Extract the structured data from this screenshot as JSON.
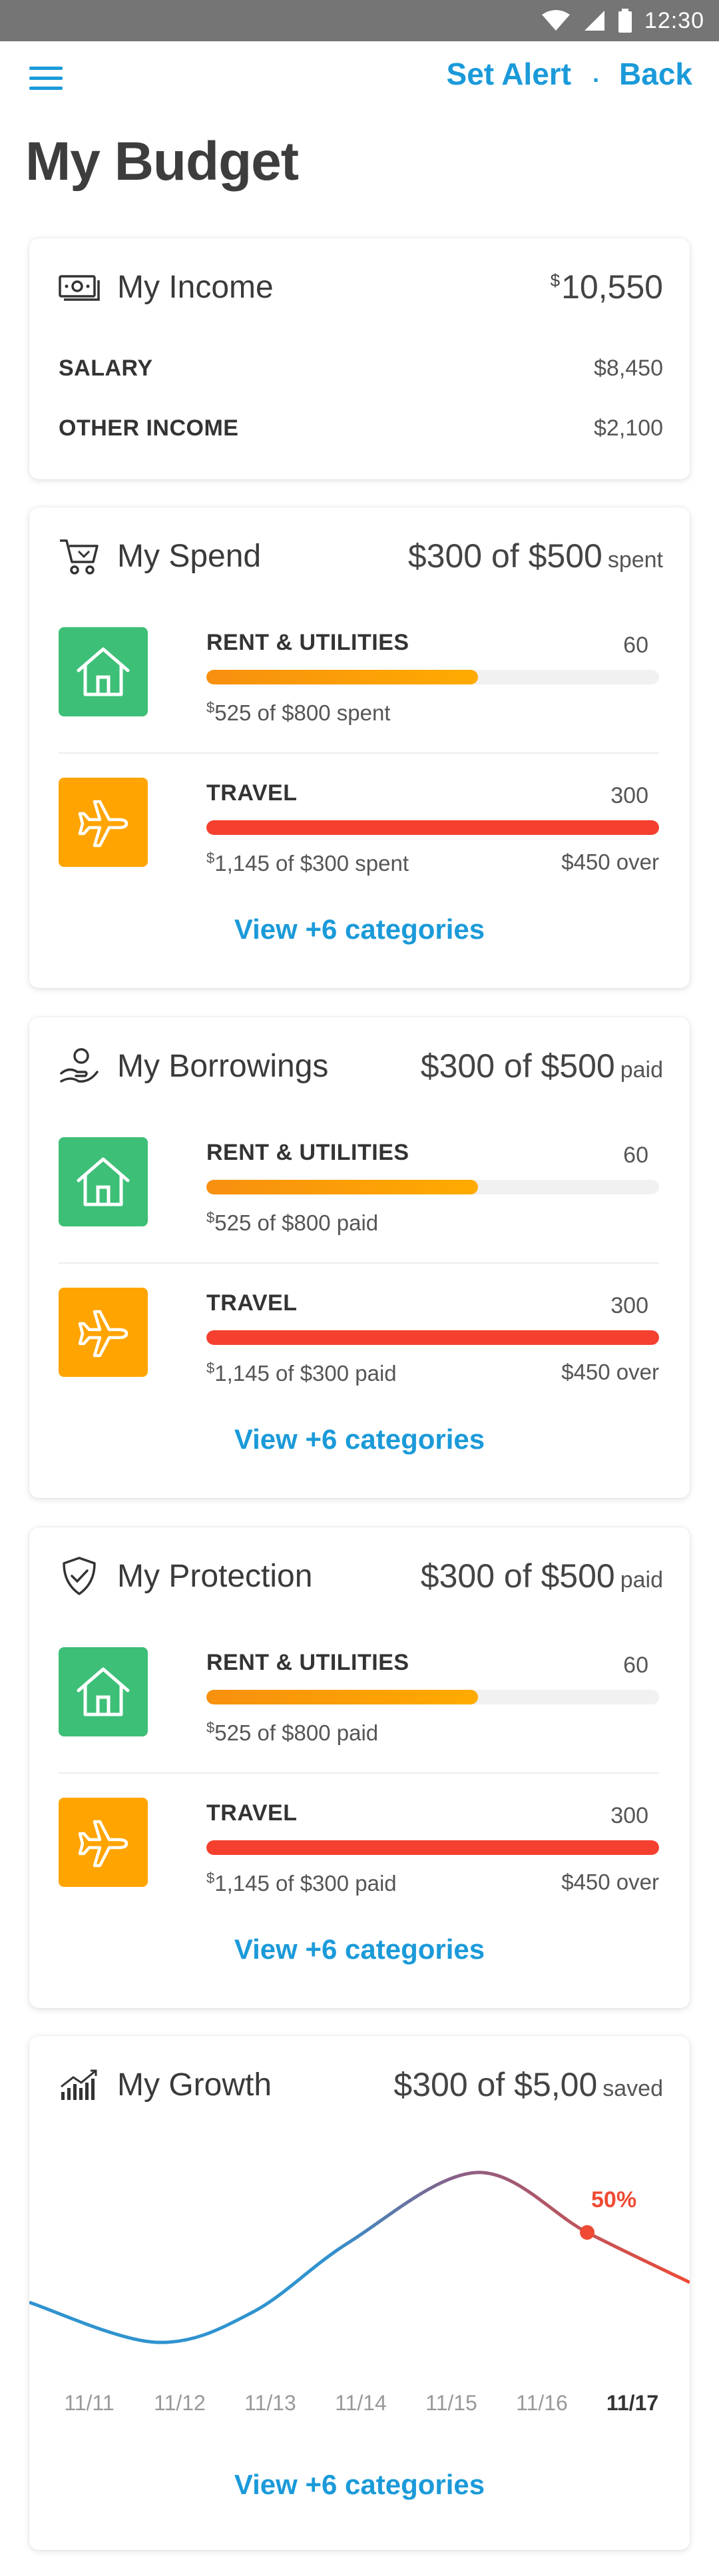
{
  "status_bar": {
    "time": "12:30"
  },
  "header": {
    "set_alert": "Set Alert",
    "separator": ".",
    "back": "Back"
  },
  "page_title": "My Budget",
  "income": {
    "title": "My Income",
    "total_currency": "$",
    "total": "10,550",
    "rows": [
      {
        "label": "SALARY",
        "value": "$8,450"
      },
      {
        "label": "OTHER INCOME",
        "value": "$2,100"
      }
    ]
  },
  "spend": {
    "title": "My Spend",
    "summary": "$300 of $500",
    "summary_suffix": "spent",
    "items": [
      {
        "name": "RENT & UTILITIES",
        "count": "60",
        "detail_currency": "$",
        "detail": "525 of $800 spent",
        "over": "",
        "progress": 0.6,
        "icon": "home-icon"
      },
      {
        "name": "TRAVEL",
        "count": "300",
        "detail_currency": "$",
        "detail": "1,145 of $300 spent",
        "over": "$450 over",
        "progress": 1.0,
        "icon": "airplane-icon"
      }
    ],
    "view_more": "View +6 categories"
  },
  "borrowings": {
    "title": "My Borrowings",
    "summary": "$300 of $500",
    "summary_suffix": "paid",
    "items": [
      {
        "name": "RENT & UTILITIES",
        "count": "60",
        "detail_currency": "$",
        "detail": "525 of $800 paid",
        "over": "",
        "progress": 0.6,
        "icon": "home-icon"
      },
      {
        "name": "TRAVEL",
        "count": "300",
        "detail_currency": "$",
        "detail": "1,145 of $300 paid",
        "over": "$450 over",
        "progress": 1.0,
        "icon": "airplane-icon"
      }
    ],
    "view_more": "View +6 categories"
  },
  "protection": {
    "title": "My Protection",
    "summary": "$300 of $500",
    "summary_suffix": "paid",
    "items": [
      {
        "name": "RENT & UTILITIES",
        "count": "60",
        "detail_currency": "$",
        "detail": "525 of $800 paid",
        "over": "",
        "progress": 0.6,
        "icon": "home-icon"
      },
      {
        "name": "TRAVEL",
        "count": "300",
        "detail_currency": "$",
        "detail": "1,145 of $300 paid",
        "over": "$450 over",
        "progress": 1.0,
        "icon": "airplane-icon"
      }
    ],
    "view_more": "View +6 categories"
  },
  "growth": {
    "title": "My Growth",
    "summary": "$300 of $5,00",
    "summary_suffix": "saved",
    "marker_label": "50%",
    "view_more": "View +6 categories"
  },
  "chart_data": {
    "type": "line",
    "title": "",
    "xlabel": "",
    "ylabel": "",
    "categories": [
      "11/11",
      "11/12",
      "11/13",
      "11/14",
      "11/15",
      "11/16",
      "11/17"
    ],
    "highlighted_category": "11/17",
    "series": [
      {
        "values": [
          0.3,
          0.1,
          0.25,
          0.6,
          0.95,
          0.65,
          0.4
        ]
      }
    ],
    "annotation": {
      "category": "11/16",
      "label": "50%"
    },
    "grid": false
  },
  "colors": {
    "accent": "#1b9ad9",
    "green_icon": "#3dbf77",
    "orange_icon": "#ffa400",
    "orange_bar_start": "#f7900f",
    "orange_bar_end": "#ffab00",
    "red_bar": "#f5402f",
    "line_start": "#2f93cf",
    "line_end": "#ef4a34"
  }
}
